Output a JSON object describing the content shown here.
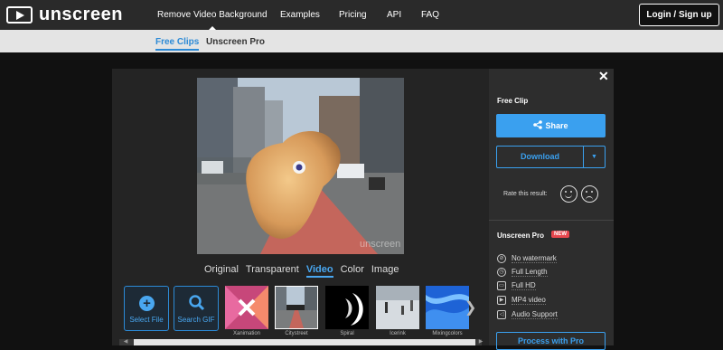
{
  "nav": {
    "logo": "unscreen",
    "links": [
      "Remove Video Background",
      "Examples",
      "Pricing",
      "API",
      "FAQ"
    ],
    "login": "Login / Sign up"
  },
  "subnav": {
    "items": [
      "Free Clips",
      "Unscreen Pro"
    ]
  },
  "preview": {
    "watermark": "unscreen"
  },
  "view_tabs": [
    "Original",
    "Transparent",
    "Video",
    "Color",
    "Image"
  ],
  "tools": {
    "select_file": "Select File",
    "search_gif": "Search GIF"
  },
  "thumbnails": [
    "Xanimation",
    "Citystreet",
    "Spiral",
    "Icerink",
    "Mixingcolors"
  ],
  "panel": {
    "close": "✕",
    "title": "Free Clip",
    "share": "Share",
    "download": "Download",
    "rate": "Rate this result:",
    "pro_title": "Unscreen Pro",
    "pro_badge": "NEW",
    "features": [
      "No watermark",
      "Full Length",
      "Full HD",
      "MP4 video",
      "Audio Support"
    ],
    "pro_button": "Process with Pro"
  },
  "colors": {
    "accent": "#3aa0ef",
    "badge": "#e6474e",
    "bg": "#111111"
  }
}
